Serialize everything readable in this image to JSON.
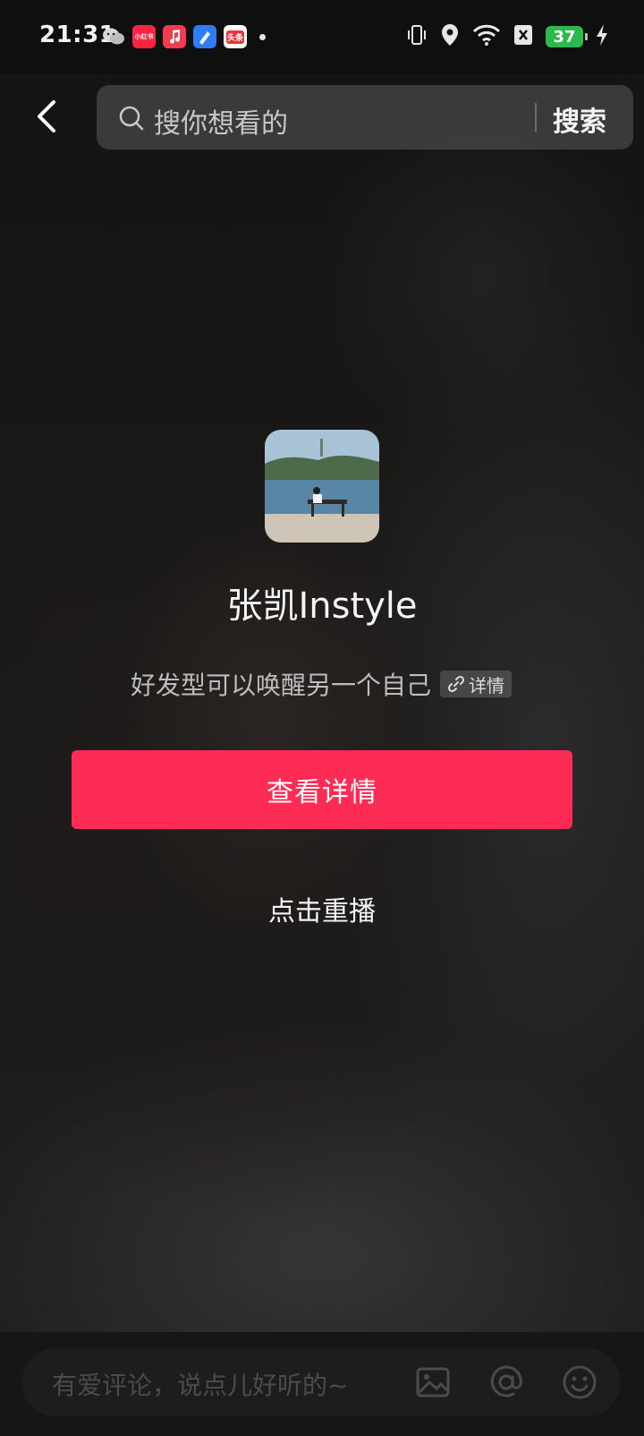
{
  "status_bar": {
    "time": "21:31",
    "battery": "37",
    "notifications": [
      {
        "icon": "wechat-icon"
      },
      {
        "icon": "xiaohongshu-icon",
        "label": "小红书",
        "color": "#ff2442"
      },
      {
        "icon": "music-icon",
        "color": "#f33b4f"
      },
      {
        "icon": "blue-app-icon",
        "color": "#2f7cf6"
      },
      {
        "icon": "toutiao-icon",
        "label": "头条",
        "color": "#e8363a"
      }
    ]
  },
  "search": {
    "placeholder": "搜你想看的",
    "button_label": "搜索"
  },
  "profile": {
    "name": "张凯Instyle",
    "tagline": "好发型可以唤醒另一个自己",
    "detail_chip_label": "详情"
  },
  "actions": {
    "view_details_label": "查看详情",
    "replay_label": "点击重播"
  },
  "comment": {
    "placeholder": "有爱评论，说点儿好听的~"
  },
  "colors": {
    "accent": "#fe2c55",
    "battery": "#2db84b"
  }
}
